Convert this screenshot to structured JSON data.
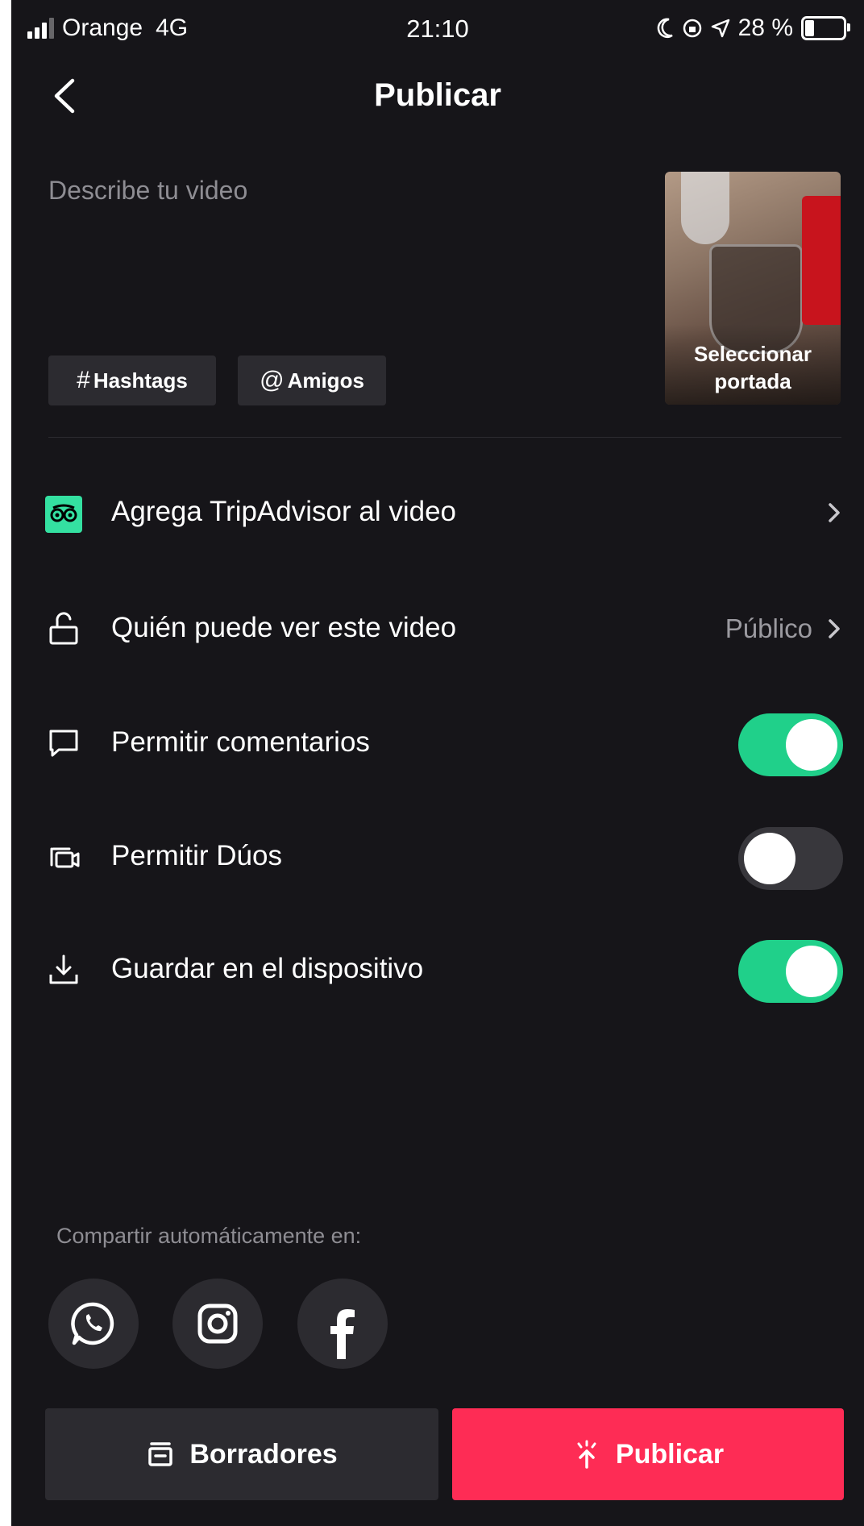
{
  "status_bar": {
    "carrier": "Orange",
    "network": "4G",
    "time": "21:10",
    "battery": "28 %",
    "battery_level": 0.28,
    "icons": [
      "signal-icon",
      "moon-icon",
      "rotation-lock-icon",
      "location-icon",
      "battery-icon"
    ]
  },
  "header": {
    "title": "Publicar",
    "back_icon": "chevron-left-icon"
  },
  "post": {
    "description_placeholder": "Describe tu video",
    "cover_label_line1": "Seleccionar",
    "cover_label_line2": "portada",
    "hashtags_symbol": "#",
    "hashtags_label": "Hashtags",
    "friends_symbol": "@",
    "friends_label": "Amigos"
  },
  "settings": {
    "tripadvisor": {
      "label": "Agrega TripAdvisor al video",
      "icon": "tripadvisor-icon"
    },
    "privacy": {
      "label": "Quién puede ver este video",
      "value": "Público",
      "icon": "lock-open-icon"
    },
    "comments": {
      "label": "Permitir comentarios",
      "enabled": true,
      "icon": "comment-icon"
    },
    "duets": {
      "label": "Permitir Dúos",
      "enabled": false,
      "icon": "duet-icon"
    },
    "save": {
      "label": "Guardar en el dispositivo",
      "enabled": true,
      "icon": "download-icon"
    }
  },
  "share": {
    "label": "Compartir automáticamente en:",
    "platforms": [
      "whatsapp-icon",
      "instagram-icon",
      "facebook-icon"
    ]
  },
  "actions": {
    "drafts_label": "Borradores",
    "publish_label": "Publicar"
  },
  "colors": {
    "background": "#161519",
    "toggle_on": "#20d08a",
    "publish": "#fe2c55",
    "tripadvisor": "#34e0a1"
  }
}
